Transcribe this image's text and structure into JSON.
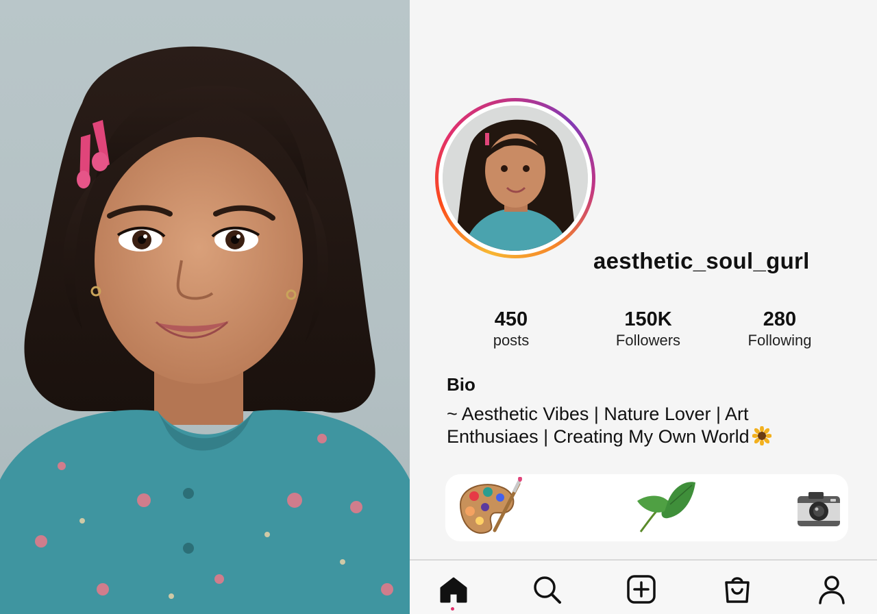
{
  "profile": {
    "username": "aesthetic_soul_gurl",
    "stats": [
      {
        "value": "450",
        "label": "posts"
      },
      {
        "value": "150K",
        "label": "Followers"
      },
      {
        "value": "280",
        "label": "Following"
      }
    ],
    "bio_title": "Bio",
    "bio_text": "~ Aesthetic Vibes | Nature Lover | Art Enthusiaes | Creating My Own World"
  },
  "highlights": [
    {
      "icon": "palette-icon"
    },
    {
      "icon": "leaf-icon"
    },
    {
      "icon": "camera-icon"
    }
  ],
  "tabbar": {
    "items": [
      "home-icon",
      "search-icon",
      "create-icon",
      "shop-icon",
      "profile-icon"
    ],
    "active": "home-icon"
  },
  "colors": {
    "story_ring": [
      "#f7b733",
      "#e1306c",
      "#833ab4"
    ],
    "active_dot": "#e1306c",
    "shirt": "#3f95a0"
  }
}
